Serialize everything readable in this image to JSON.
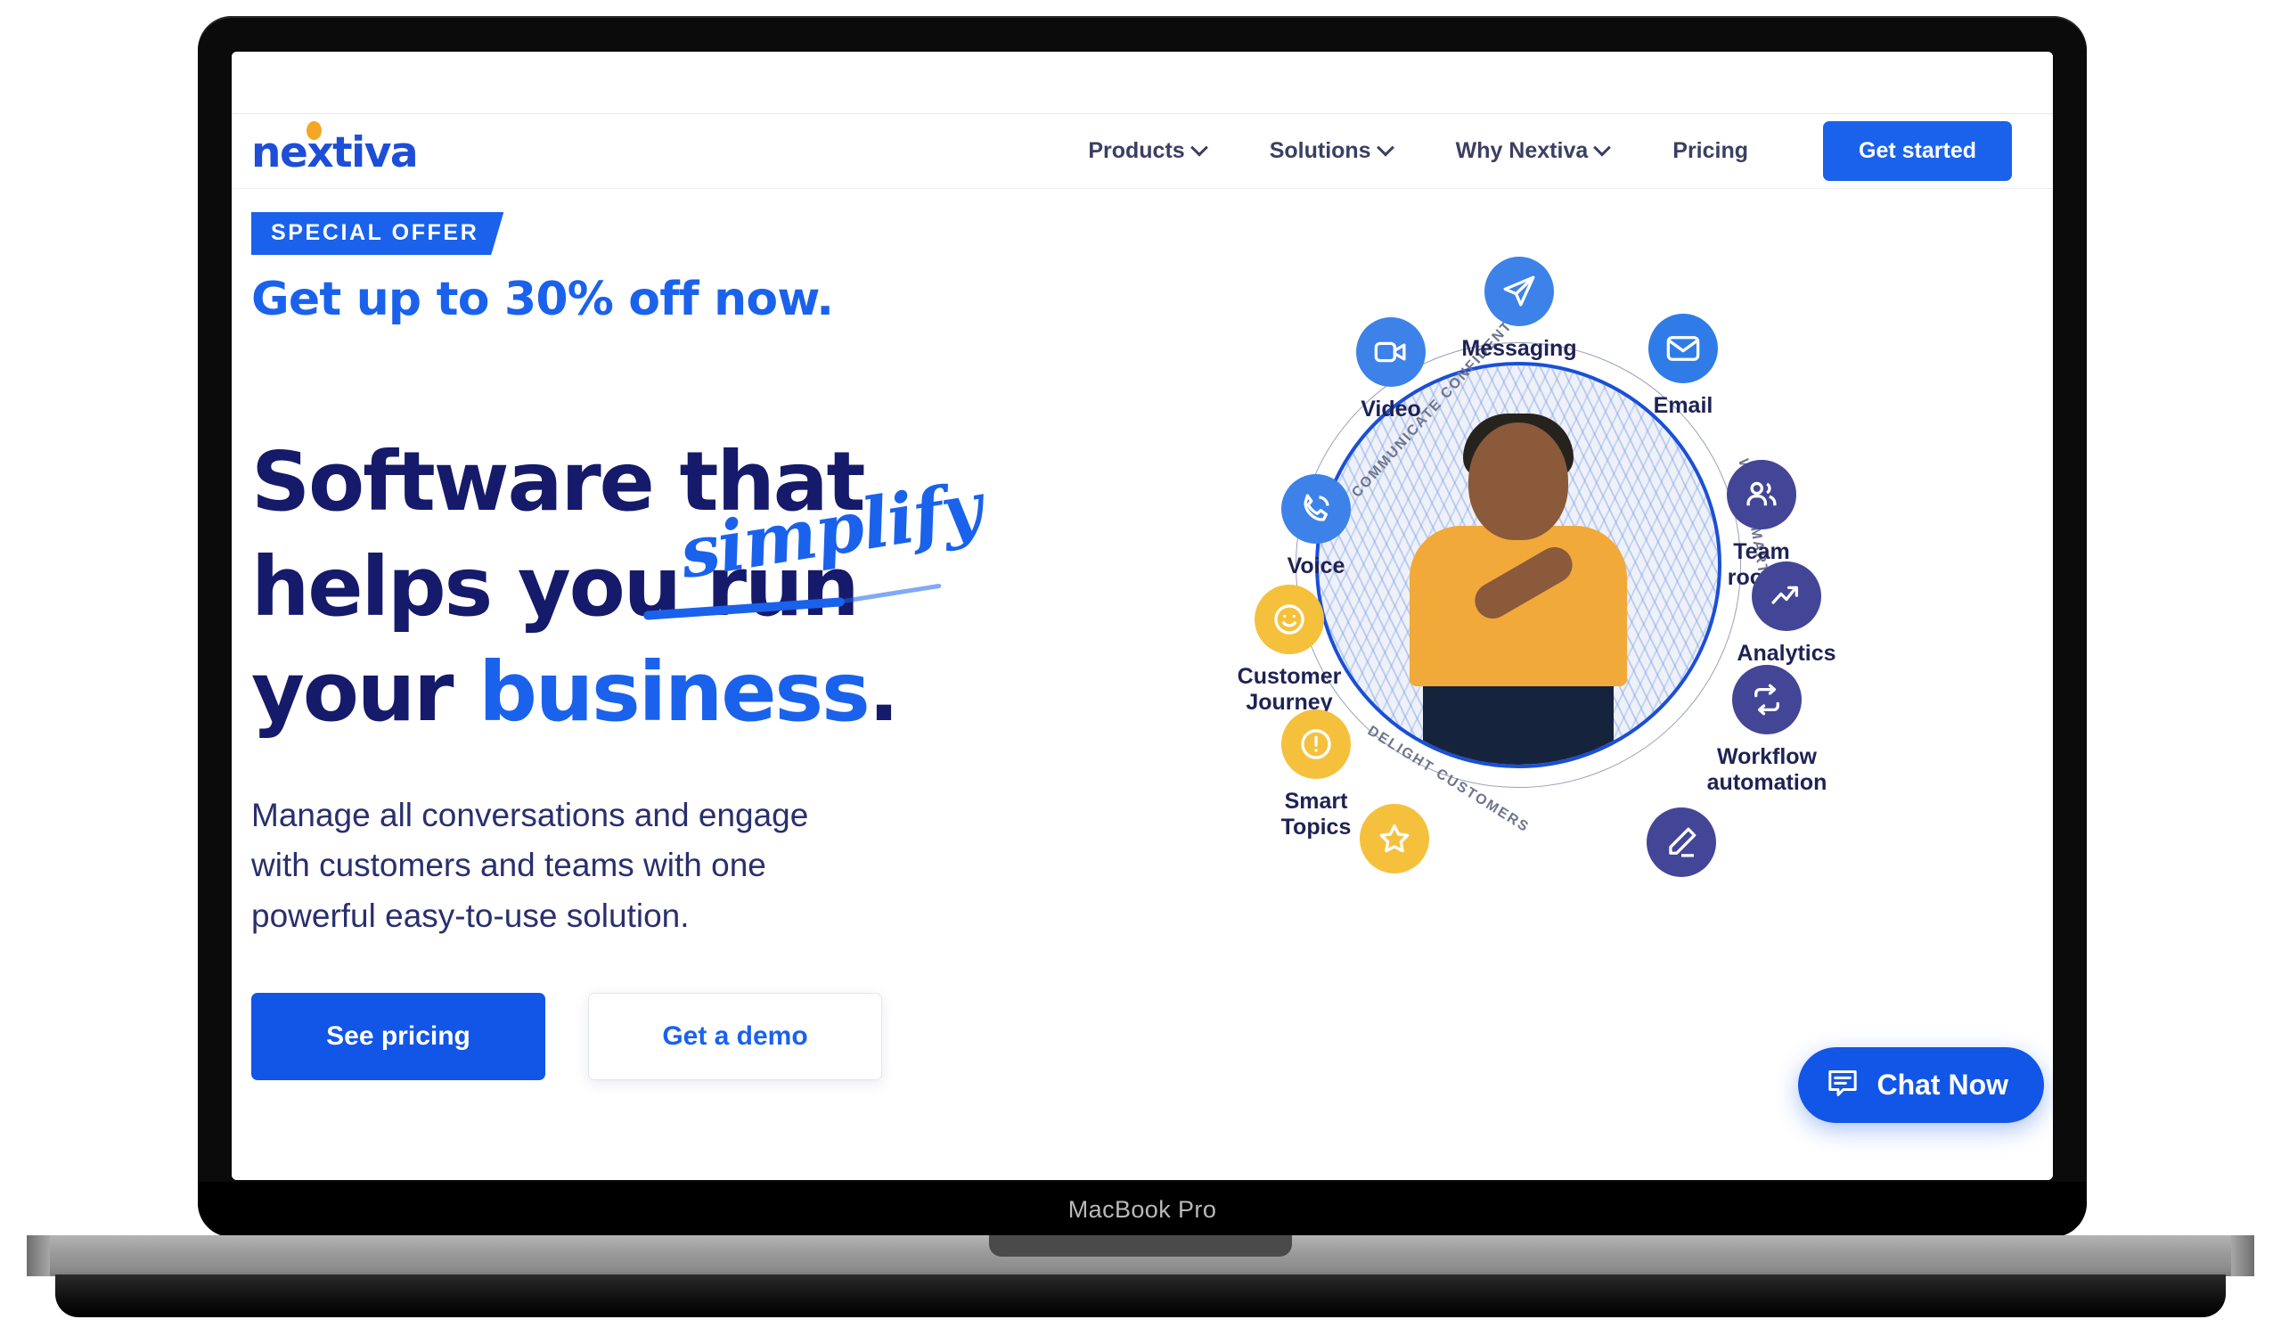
{
  "device": {
    "brand_label": "MacBook Pro"
  },
  "nav": {
    "logo_text": "nextiva",
    "links": [
      {
        "label": "Products",
        "has_dropdown": true
      },
      {
        "label": "Solutions",
        "has_dropdown": true
      },
      {
        "label": "Why Nextiva",
        "has_dropdown": true
      },
      {
        "label": "Pricing",
        "has_dropdown": false
      }
    ],
    "cta_label": "Get started"
  },
  "hero": {
    "badge": "SPECIAL OFFER",
    "offer_headline": "Get up to 30% off now.",
    "headline_line1": "Software that",
    "headline_line2_pre": "helps you ",
    "headline_line2_struck": "run",
    "headline_line3_pre": "your ",
    "headline_line3_accent": "business",
    "headline_line3_post": ".",
    "handwritten_note": "simplify",
    "subheading": "Manage all conversations and engage with customers and teams with one powerful easy-to-use solution.",
    "cta_primary": "See pricing",
    "cta_secondary": "Get a demo"
  },
  "illustration": {
    "orbit_labels": {
      "top": "COMMUNICATE CONFIDENTLY",
      "right": "WORK SMARTER",
      "bottom": "DELIGHT CUSTOMERS"
    },
    "features": [
      {
        "id": "messaging",
        "label": "Messaging",
        "icon": "paper-plane-icon",
        "color": "#3d82e8"
      },
      {
        "id": "video",
        "label": "Video",
        "icon": "video-camera-icon",
        "color": "#3d82e8"
      },
      {
        "id": "email",
        "label": "Email",
        "icon": "envelope-icon",
        "color": "#2f7ce8"
      },
      {
        "id": "voice",
        "label": "Voice",
        "icon": "phone-icon",
        "color": "#3d82e8"
      },
      {
        "id": "teamrooms",
        "label": "Team\nrooms",
        "icon": "people-icon",
        "color": "#434596"
      },
      {
        "id": "journey",
        "label": "Customer\nJourney",
        "icon": "smiley-icon",
        "color": "#f5c13d"
      },
      {
        "id": "analytics",
        "label": "Analytics",
        "icon": "trend-up-icon",
        "color": "#434596"
      },
      {
        "id": "smarttopics",
        "label": "Smart\nTopics",
        "icon": "alert-icon",
        "color": "#f5c13d"
      },
      {
        "id": "automation",
        "label": "Workflow\nautomation",
        "icon": "repeat-icon",
        "color": "#434596"
      },
      {
        "id": "reviews",
        "label": "",
        "icon": "star-icon",
        "color": "#f5c13d"
      },
      {
        "id": "surveys",
        "label": "",
        "icon": "pencil-icon",
        "color": "#434596"
      }
    ]
  },
  "chat": {
    "label": "Chat Now",
    "icon": "chat-bubble-icon"
  },
  "colors": {
    "brand_blue": "#1a62ec",
    "deep_navy": "#151a6a",
    "amber": "#f5c13d",
    "indigo": "#434596",
    "logo_dot": "#f5a623"
  }
}
